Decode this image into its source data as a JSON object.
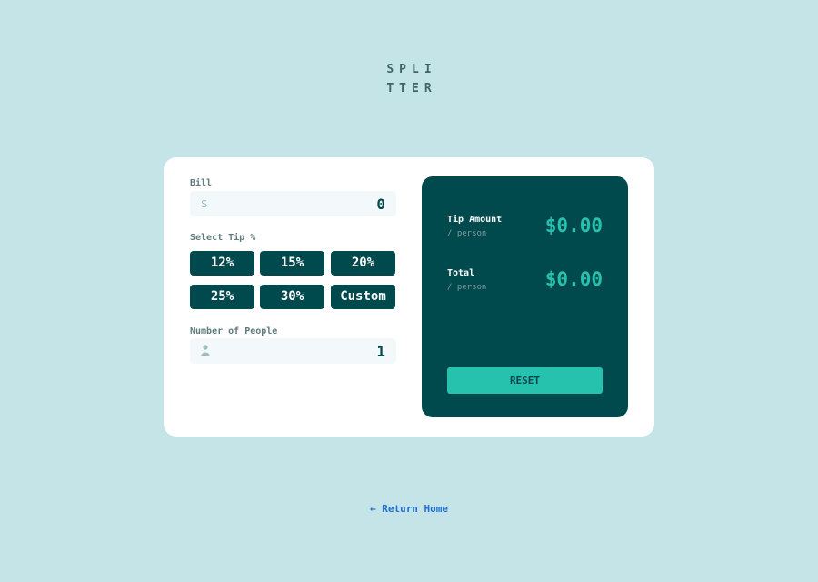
{
  "logo": {
    "line1": "SPLI",
    "line2": "TTER"
  },
  "bill": {
    "label": "Bill",
    "prefix": "$",
    "value": "0"
  },
  "tip": {
    "label": "Select Tip %",
    "options": [
      "12%",
      "15%",
      "20%",
      "25%",
      "30%",
      "Custom"
    ]
  },
  "people": {
    "label": "Number of People",
    "icon": "person-icon",
    "value": "1"
  },
  "results": {
    "tip_amount_label": "Tip Amount",
    "tip_amount_sub": "/ person",
    "tip_amount_value": "$0.00",
    "total_label": "Total",
    "total_sub": "/ person",
    "total_value": "$0.00",
    "reset_label": "RESET"
  },
  "footer": {
    "return_home": "← Return Home"
  },
  "colors": {
    "background": "#c5e4e7",
    "dark_teal": "#00494d",
    "accent": "#26c2ad",
    "link": "#1f6fd0"
  }
}
